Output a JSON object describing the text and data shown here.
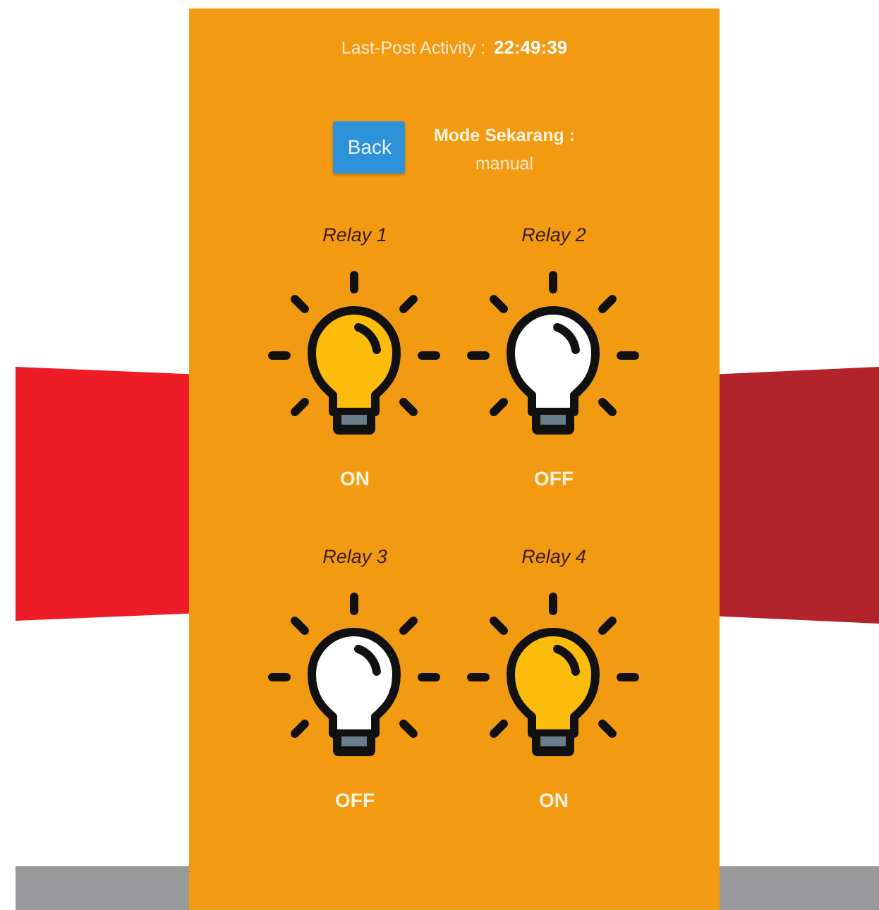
{
  "last_post": {
    "label": "Last-Post Activity :",
    "time": "22:49:39"
  },
  "back_button": {
    "label": "Back"
  },
  "mode": {
    "label": "Mode Sekarang :",
    "value": "manual"
  },
  "relays": [
    {
      "name": "Relay 1",
      "on": true,
      "status": "ON"
    },
    {
      "name": "Relay 2",
      "on": false,
      "status": "OFF"
    },
    {
      "name": "Relay 3",
      "on": false,
      "status": "OFF"
    },
    {
      "name": "Relay 4",
      "on": true,
      "status": "ON"
    }
  ]
}
